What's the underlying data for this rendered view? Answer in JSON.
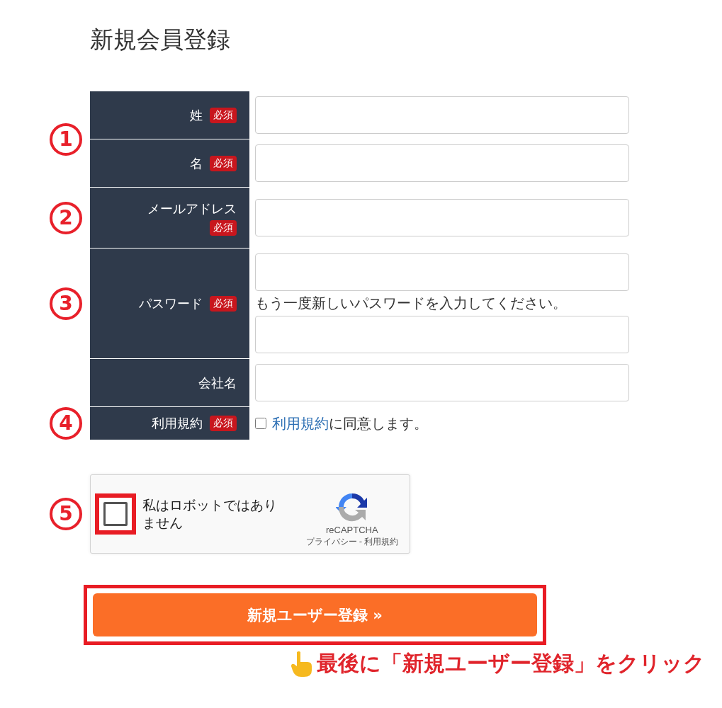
{
  "title": "新規会員登録",
  "groups": [
    {
      "marker": "1",
      "fields": [
        {
          "kind": "text",
          "label": "姓",
          "badge": "必須"
        },
        {
          "kind": "text",
          "label": "名",
          "badge": "必須"
        }
      ]
    },
    {
      "marker": "2",
      "fields": [
        {
          "kind": "text",
          "label": "メールアドレス",
          "badge": "必須"
        }
      ]
    },
    {
      "marker": "3",
      "fields": [
        {
          "kind": "password",
          "label": "パスワード",
          "badge": "必須",
          "help": "もう一度新しいパスワードを入力してください。"
        }
      ]
    },
    {
      "fields": [
        {
          "kind": "text",
          "label": "会社名"
        }
      ]
    },
    {
      "marker": "4",
      "fields": [
        {
          "kind": "agreement",
          "label": "利用規約",
          "badge": "必須",
          "checked": false,
          "link": "利用規約",
          "text": "に同意します。"
        }
      ]
    }
  ],
  "captcha": {
    "marker": "5",
    "label": "私はロボットではありません",
    "checked": false,
    "brand": "reCAPTCHA",
    "links": [
      "プライバシー",
      "利用規約"
    ],
    "separator": "-"
  },
  "submit": "新規ユーザー登録 »",
  "note": "最後に「新規ユーザー登録」をクリック"
}
